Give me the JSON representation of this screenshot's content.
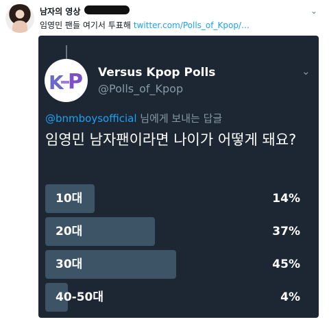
{
  "tweet": {
    "author": "남자의 영상",
    "text": "임영민 팬들 여기서 투표해",
    "link": "twitter.com/Polls_of_Kpop/…"
  },
  "quoted": {
    "name": "Versus Kpop Polls",
    "handle": "@Polls_of_Kpop",
    "reply_mention": "@bnmboysofficial",
    "reply_suffix": "님에게 보내는 답글",
    "question": "임영민 남자팬이라면 나이가 어떻게 돼요?",
    "options": [
      {
        "label": "10대",
        "percent": "14%",
        "value": 14
      },
      {
        "label": "20대",
        "percent": "37%",
        "value": 37
      },
      {
        "label": "30대",
        "percent": "45%",
        "value": 45
      },
      {
        "label": "40-50대",
        "percent": "4%",
        "value": 4
      }
    ]
  },
  "icons": {
    "caret": "chevron-down-icon",
    "card_caret": "chevron-down-icon"
  },
  "colors": {
    "card": "#1c2733",
    "bar": "#3d5466",
    "link": "#1da1f2"
  }
}
